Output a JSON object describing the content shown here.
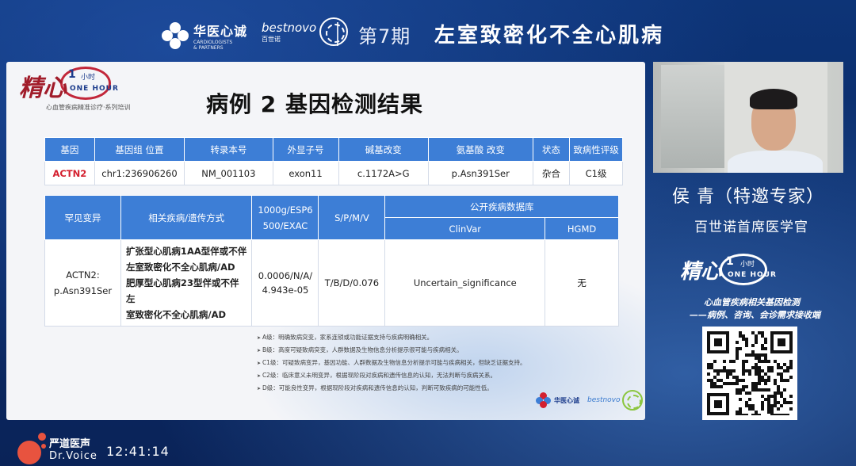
{
  "header": {
    "logo_huayi_cn": "华医心诚",
    "logo_huayi_en1": "CARDIOLOGISTS",
    "logo_huayi_en2": "& PARTNERS",
    "logo_bestnovo_en": "bestnovo",
    "logo_bestnovo_cn": "百世诺",
    "issue": "第7期",
    "headline": "左室致密化不全心肌病"
  },
  "slide": {
    "logo": {
      "main": "精心",
      "number": "1",
      "unit": "小时",
      "english": "ONE HOUR",
      "subtitle": "心血管疾病精准诊疗·系列培训"
    },
    "title": "病例 2 基因检测结果",
    "table1": {
      "headers": [
        "基因",
        "基因组 位置",
        "转录本号",
        "外显子号",
        "碱基改变",
        "氨基酸 改变",
        "状态",
        "致病性评级"
      ],
      "row": [
        "ACTN2",
        "chr1:236906260",
        "NM_001103",
        "exon11",
        "c.1172A>G",
        "p.Asn391Ser",
        "杂合",
        "C1级"
      ]
    },
    "table2": {
      "h_variant": "罕见变异",
      "h_disease": "相关疾病/遗传方式",
      "h_freq_line1": "1000g/ESP6",
      "h_freq_line2": "500/EXAC",
      "h_spmv": "S/P/M/V",
      "h_db": "公开疾病数据库",
      "h_clinvar": "ClinVar",
      "h_hgmd": "HGMD",
      "variant_line1": "ACTN2:",
      "variant_line2": "p.Asn391Ser",
      "disease_lines": [
        "扩张型心肌病1AA型伴或不伴",
        "左室致密化不全心肌病/AD",
        "肥厚型心肌病23型伴或不伴左",
        "室致密化不全心肌病/AD"
      ],
      "freq_line1": "0.0006/N/A/",
      "freq_line2": "4.943e-05",
      "spmv": "T/B/D/0.076",
      "clinvar": "Uncertain_significance",
      "hgmd": "无"
    },
    "notes": [
      "A级：明确致病突变，家系连锁或功能证据支持与疾病明确相关。",
      "B级：高度可疑致病突变，人群数据及生物信息分析提示很可能与疾病相关。",
      "C1级：可疑致病变异，基因功能、人群数据及生物信息分析提示可能与疾病相关，但缺乏证据支持。",
      "C2级：临床意义未明变异，根据现阶段对疾病和遗传信息的认知，无法判断与疾病关系。",
      "D级：可能良性变异，根据现阶段对疾病和遗传信息的认知，判断可致疾病的可能性低。"
    ],
    "footer_huayi": "华医心诚",
    "footer_bestnovo": "bestnovo"
  },
  "speaker": {
    "name": "侯 青（特邀专家）",
    "title": "百世诺首席医学官"
  },
  "side": {
    "logo_main": "精心",
    "logo_number": "1",
    "logo_unit": "小时",
    "logo_english": "ONE HOUR",
    "promo_line1": "心血管疾病相关基因检测",
    "promo_line2": "——病例、咨询、会诊需求接收端"
  },
  "bottom": {
    "dv_cn": "严道医声",
    "dv_en": "Dr.Voice",
    "time": "12:41:14"
  },
  "colors": {
    "background": "#0b2a63",
    "table_header": "#3d7ed6",
    "gene_red": "#d4202f"
  }
}
